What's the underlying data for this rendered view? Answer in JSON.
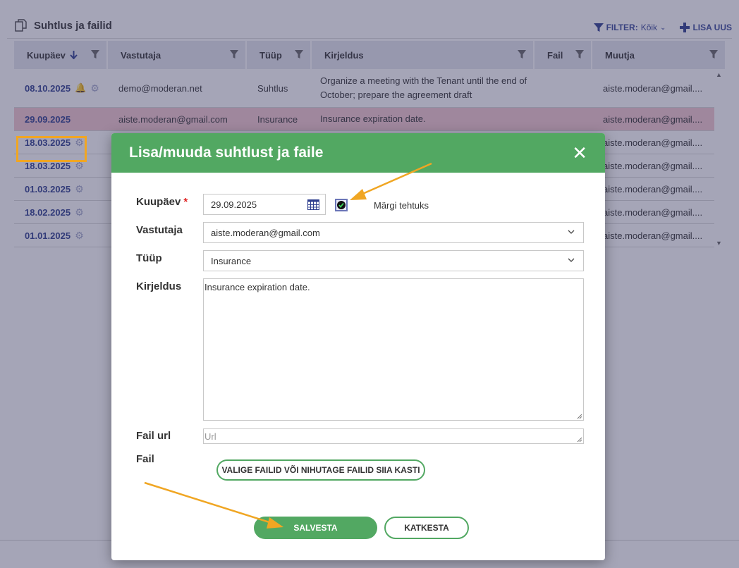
{
  "panel": {
    "title": "Suhtlus ja failid"
  },
  "toolbar": {
    "filter_label": "FILTER:",
    "filter_value": "Kõik",
    "add_label": "LISA UUS"
  },
  "grid": {
    "headers": [
      "Kuupäev",
      "Vastutaja",
      "Tüüp",
      "Kirjeldus",
      "Fail",
      "Muutja"
    ],
    "rows": [
      {
        "date": "08.10.2025",
        "responsible": "demo@moderan.net",
        "type": "Suhtlus",
        "description": "Organize a meeting with the Tenant until the end of October; prepare the agreement draft",
        "file": "",
        "modifier": "aiste.moderan@gmail...."
      },
      {
        "date": "29.09.2025",
        "responsible": "aiste.moderan@gmail.com",
        "type": "Insurance",
        "description": "Insurance expiration date.",
        "file": "",
        "modifier": "aiste.moderan@gmail...."
      },
      {
        "date": "18.03.2025",
        "modifier": "aiste.moderan@gmail...."
      },
      {
        "date": "18.03.2025",
        "modifier": "aiste.moderan@gmail...."
      },
      {
        "date": "01.03.2025",
        "modifier": "aiste.moderan@gmail...."
      },
      {
        "date": "18.02.2025",
        "modifier": "aiste.moderan@gmail...."
      },
      {
        "date": "01.01.2025",
        "modifier": "aiste.moderan@gmail...."
      }
    ]
  },
  "modal": {
    "title": "Lisa/muuda suhtlust ja faile",
    "date_label": "Kuupäev",
    "required_mark": "*",
    "date_value": "29.09.2025",
    "done_label": "Märgi tehtuks",
    "done_checked": true,
    "responsible_label": "Vastutaja",
    "responsible_value": "aiste.moderan@gmail.com",
    "type_label": "Tüüp",
    "type_value": "Insurance",
    "description_label": "Kirjeldus",
    "description_value": "Insurance expiration date.",
    "url_label": "Fail url",
    "url_placeholder": "Url",
    "file_label": "Fail",
    "file_button": "VALIGE FAILID VÕI NIHUTAGE FAILID SIIA KASTI",
    "save_button": "SALVESTA",
    "cancel_button": "KATKESTA"
  },
  "colors": {
    "accent_green": "#52a862",
    "link_blue": "#2f3f8f",
    "highlight_row": "#f5c8cf",
    "annotation_arrow": "#f0a623"
  }
}
